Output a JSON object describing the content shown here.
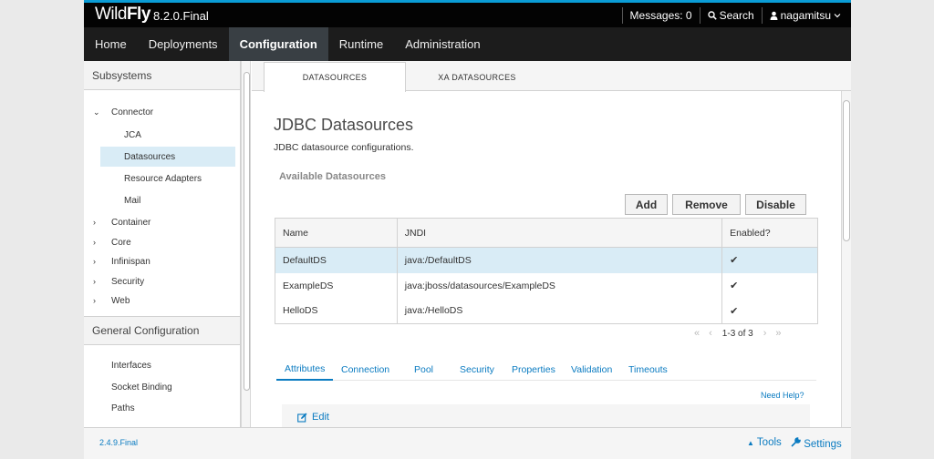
{
  "topbar": {
    "brand_prefix": "Wild",
    "brand_bold": "Fly",
    "version": "8.2.0.Final",
    "messages": "Messages: 0",
    "search": "Search",
    "user": "nagamitsu"
  },
  "nav": {
    "items": [
      "Home",
      "Deployments",
      "Configuration",
      "Runtime",
      "Administration"
    ],
    "active": "Configuration"
  },
  "sidebar": {
    "subsystems_header": "Subsystems",
    "connector": "Connector",
    "jca": "JCA",
    "datasources": "Datasources",
    "resource_adapters": "Resource Adapters",
    "mail": "Mail",
    "container": "Container",
    "core": "Core",
    "infinispan": "Infinispan",
    "security": "Security",
    "web": "Web",
    "general_header": "General Configuration",
    "interfaces": "Interfaces",
    "socket_binding": "Socket Binding",
    "paths": "Paths"
  },
  "tabs": {
    "datasources": "DATASOURCES",
    "xa_datasources": "XA DATASOURCES"
  },
  "main": {
    "title": "JDBC Datasources",
    "description": "JDBC datasource configurations.",
    "available": "Available Datasources",
    "add_label": "Add",
    "remove_label": "Remove",
    "disable_label": "Disable"
  },
  "table": {
    "headers": [
      "Name",
      "JNDI",
      "Enabled?"
    ],
    "rows": [
      {
        "name": "DefaultDS",
        "jndi": "java:/DefaultDS",
        "enabled": "✔"
      },
      {
        "name": "ExampleDS",
        "jndi": "java:jboss/datasources/ExampleDS",
        "enabled": "✔"
      },
      {
        "name": "HelloDS",
        "jndi": "java:/HelloDS",
        "enabled": "✔"
      }
    ],
    "pager": "1-3 of 3"
  },
  "subtabs": {
    "attributes": "Attributes",
    "connection": "Connection",
    "pool": "Pool",
    "security": "Security",
    "properties": "Properties",
    "validation": "Validation",
    "timeouts": "Timeouts"
  },
  "detail": {
    "need_help": "Need Help?",
    "edit": "Edit"
  },
  "footer": {
    "version": "2.4.9.Final",
    "tools": "Tools",
    "settings": "Settings"
  },
  "colors": {
    "accent": "#0a7bc1",
    "topbar": "#030303",
    "nav": "#1c1c1c",
    "nav_active": "#393f44",
    "selection": "#d9ecf6"
  }
}
